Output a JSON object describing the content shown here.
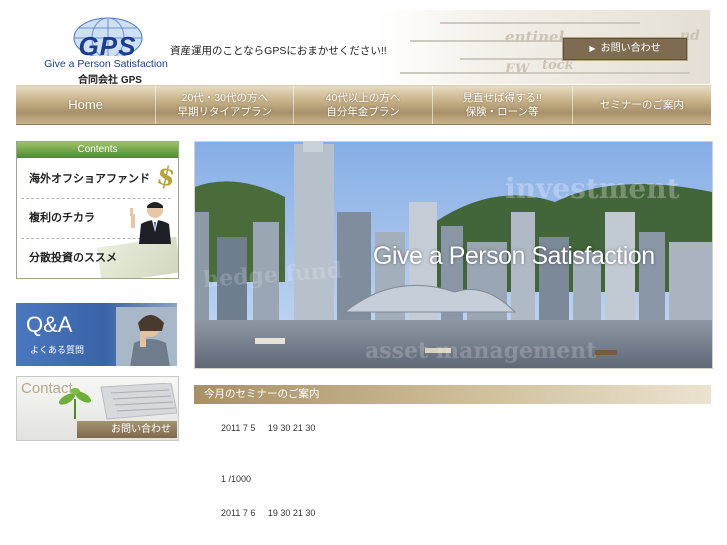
{
  "header": {
    "logo_text": "GPS",
    "logo_tagline": "Give a Person Satisfaction",
    "logo_company": "合同会社 GPS",
    "tagline": "資産運用のことならGPSにおまかせください!!",
    "contact_button": "お問い合わせ",
    "background_words": [
      "entinel",
      "tock",
      "EW",
      "nd"
    ]
  },
  "nav": {
    "items": [
      {
        "lines": [
          "Home"
        ]
      },
      {
        "lines": [
          "20代・30代の方へ",
          "早期リタイアプラン"
        ]
      },
      {
        "lines": [
          "40代以上の方へ",
          "自分年金プラン"
        ]
      },
      {
        "lines": [
          "見直せば得する!!",
          "保険・ローン等"
        ]
      },
      {
        "lines": [
          "セミナーのご案内"
        ]
      }
    ]
  },
  "sidebar": {
    "contents_title": "Contents",
    "contents_items": [
      "海外オフショアファンド",
      "複利のチカラ",
      "分散投資のススメ"
    ],
    "dollar_glyph": "$",
    "qa_title": "Q&A",
    "qa_subtitle": "よくある質問",
    "contact_title": "Contact",
    "contact_subtitle": "お問い合わせ"
  },
  "hero": {
    "caption": "Give a Person Satisfaction",
    "watermarks": [
      "investment",
      "hedge fund",
      "asset management"
    ]
  },
  "seminar": {
    "title": "今月のセミナーのご案内",
    "lines": [
      "2011 7 5     19 30 21 30",
      "1 /1000",
      "2011 7 6     19 30 21 30"
    ]
  },
  "colors": {
    "brand_blue": "#1a3d8f",
    "nav_gold": "#b8a27a",
    "contents_green": "#6aa33a",
    "qa_blue": "#3e6db3"
  }
}
